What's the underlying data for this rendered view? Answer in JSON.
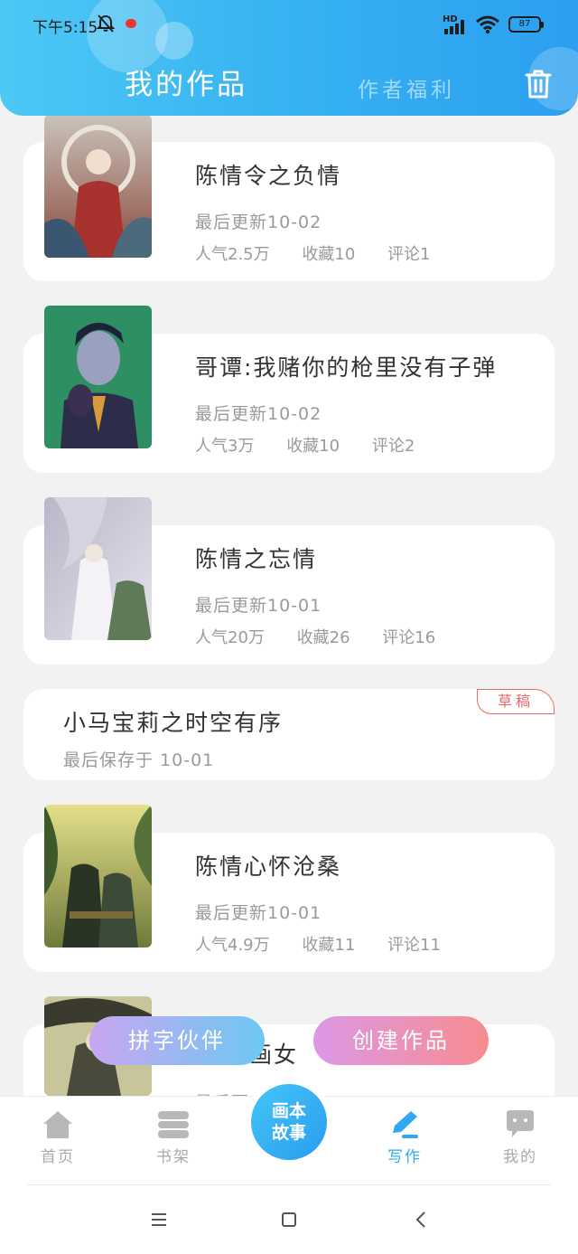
{
  "status_bar": {
    "time": "下午5:15",
    "network": "HD",
    "battery": "87"
  },
  "header": {
    "title": "我的作品",
    "subtitle": "作者福利"
  },
  "works": [
    {
      "title": "陈情令之负情",
      "updated": "最后更新10-02",
      "popularity": "人气2.5万",
      "favorites": "收藏10",
      "comments": "评论1"
    },
    {
      "title": "哥谭:我赌你的枪里没有子弹",
      "updated": "最后更新10-02",
      "popularity": "人气3万",
      "favorites": "收藏10",
      "comments": "评论2"
    },
    {
      "title": "陈情之忘情",
      "updated": "最后更新10-01",
      "popularity": "人气20万",
      "favorites": "收藏26",
      "comments": "评论16"
    },
    {
      "title": "陈情心怀沧桑",
      "updated": "最后更新10-01",
      "popularity": "人气4.9万",
      "favorites": "收藏11",
      "comments": "评论11"
    },
    {
      "title": "画女",
      "updated": "最后更",
      "popularity": "",
      "favorites": "",
      "comments": ""
    }
  ],
  "draft": {
    "title": "小马宝莉之时空有序",
    "saved": "最后保存于 10-01",
    "badge": "草稿"
  },
  "actions": {
    "partner": "拼字伙伴",
    "create": "创建作品"
  },
  "nav": {
    "home": "首页",
    "shelf": "书架",
    "center_line1": "画本",
    "center_line2": "故事",
    "write": "写作",
    "mine": "我的"
  }
}
